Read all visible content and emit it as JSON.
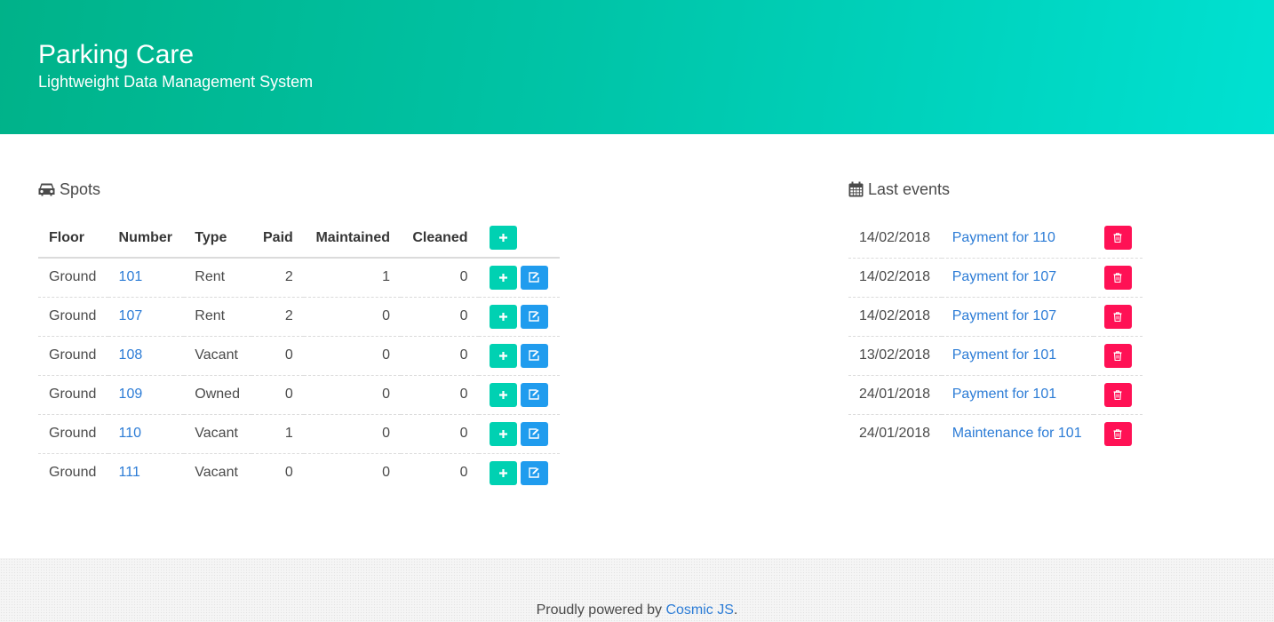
{
  "hero": {
    "title": "Parking Care",
    "subtitle": "Lightweight Data Management System"
  },
  "spots": {
    "title": "Spots",
    "icon": "car-icon",
    "columns": [
      "Floor",
      "Number",
      "Type",
      "Paid",
      "Maintained",
      "Cleaned"
    ],
    "rows": [
      {
        "floor": "Ground",
        "number": "101",
        "type": "Rent",
        "paid": "2",
        "maintained": "1",
        "cleaned": "0"
      },
      {
        "floor": "Ground",
        "number": "107",
        "type": "Rent",
        "paid": "2",
        "maintained": "0",
        "cleaned": "0"
      },
      {
        "floor": "Ground",
        "number": "108",
        "type": "Vacant",
        "paid": "0",
        "maintained": "0",
        "cleaned": "0"
      },
      {
        "floor": "Ground",
        "number": "109",
        "type": "Owned",
        "paid": "0",
        "maintained": "0",
        "cleaned": "0"
      },
      {
        "floor": "Ground",
        "number": "110",
        "type": "Vacant",
        "paid": "1",
        "maintained": "0",
        "cleaned": "0"
      },
      {
        "floor": "Ground",
        "number": "111",
        "type": "Vacant",
        "paid": "0",
        "maintained": "0",
        "cleaned": "0"
      }
    ]
  },
  "events": {
    "title": "Last events",
    "icon": "calendar-icon",
    "rows": [
      {
        "date": "14/02/2018",
        "label": "Payment for 110"
      },
      {
        "date": "14/02/2018",
        "label": "Payment for 107"
      },
      {
        "date": "14/02/2018",
        "label": "Payment for 107"
      },
      {
        "date": "13/02/2018",
        "label": "Payment for 101"
      },
      {
        "date": "24/01/2018",
        "label": "Payment for 101"
      },
      {
        "date": "24/01/2018",
        "label": "Maintenance for 101"
      }
    ]
  },
  "footer": {
    "prefix": "Proudly powered by ",
    "link": "Cosmic JS",
    "suffix": "."
  },
  "colors": {
    "brand_start": "#00b289",
    "brand_end": "#00e1d2",
    "add_button": "#00d1b2",
    "edit_button": "#209cee",
    "delete_button": "#ff1155",
    "link": "#2c7cd6"
  }
}
